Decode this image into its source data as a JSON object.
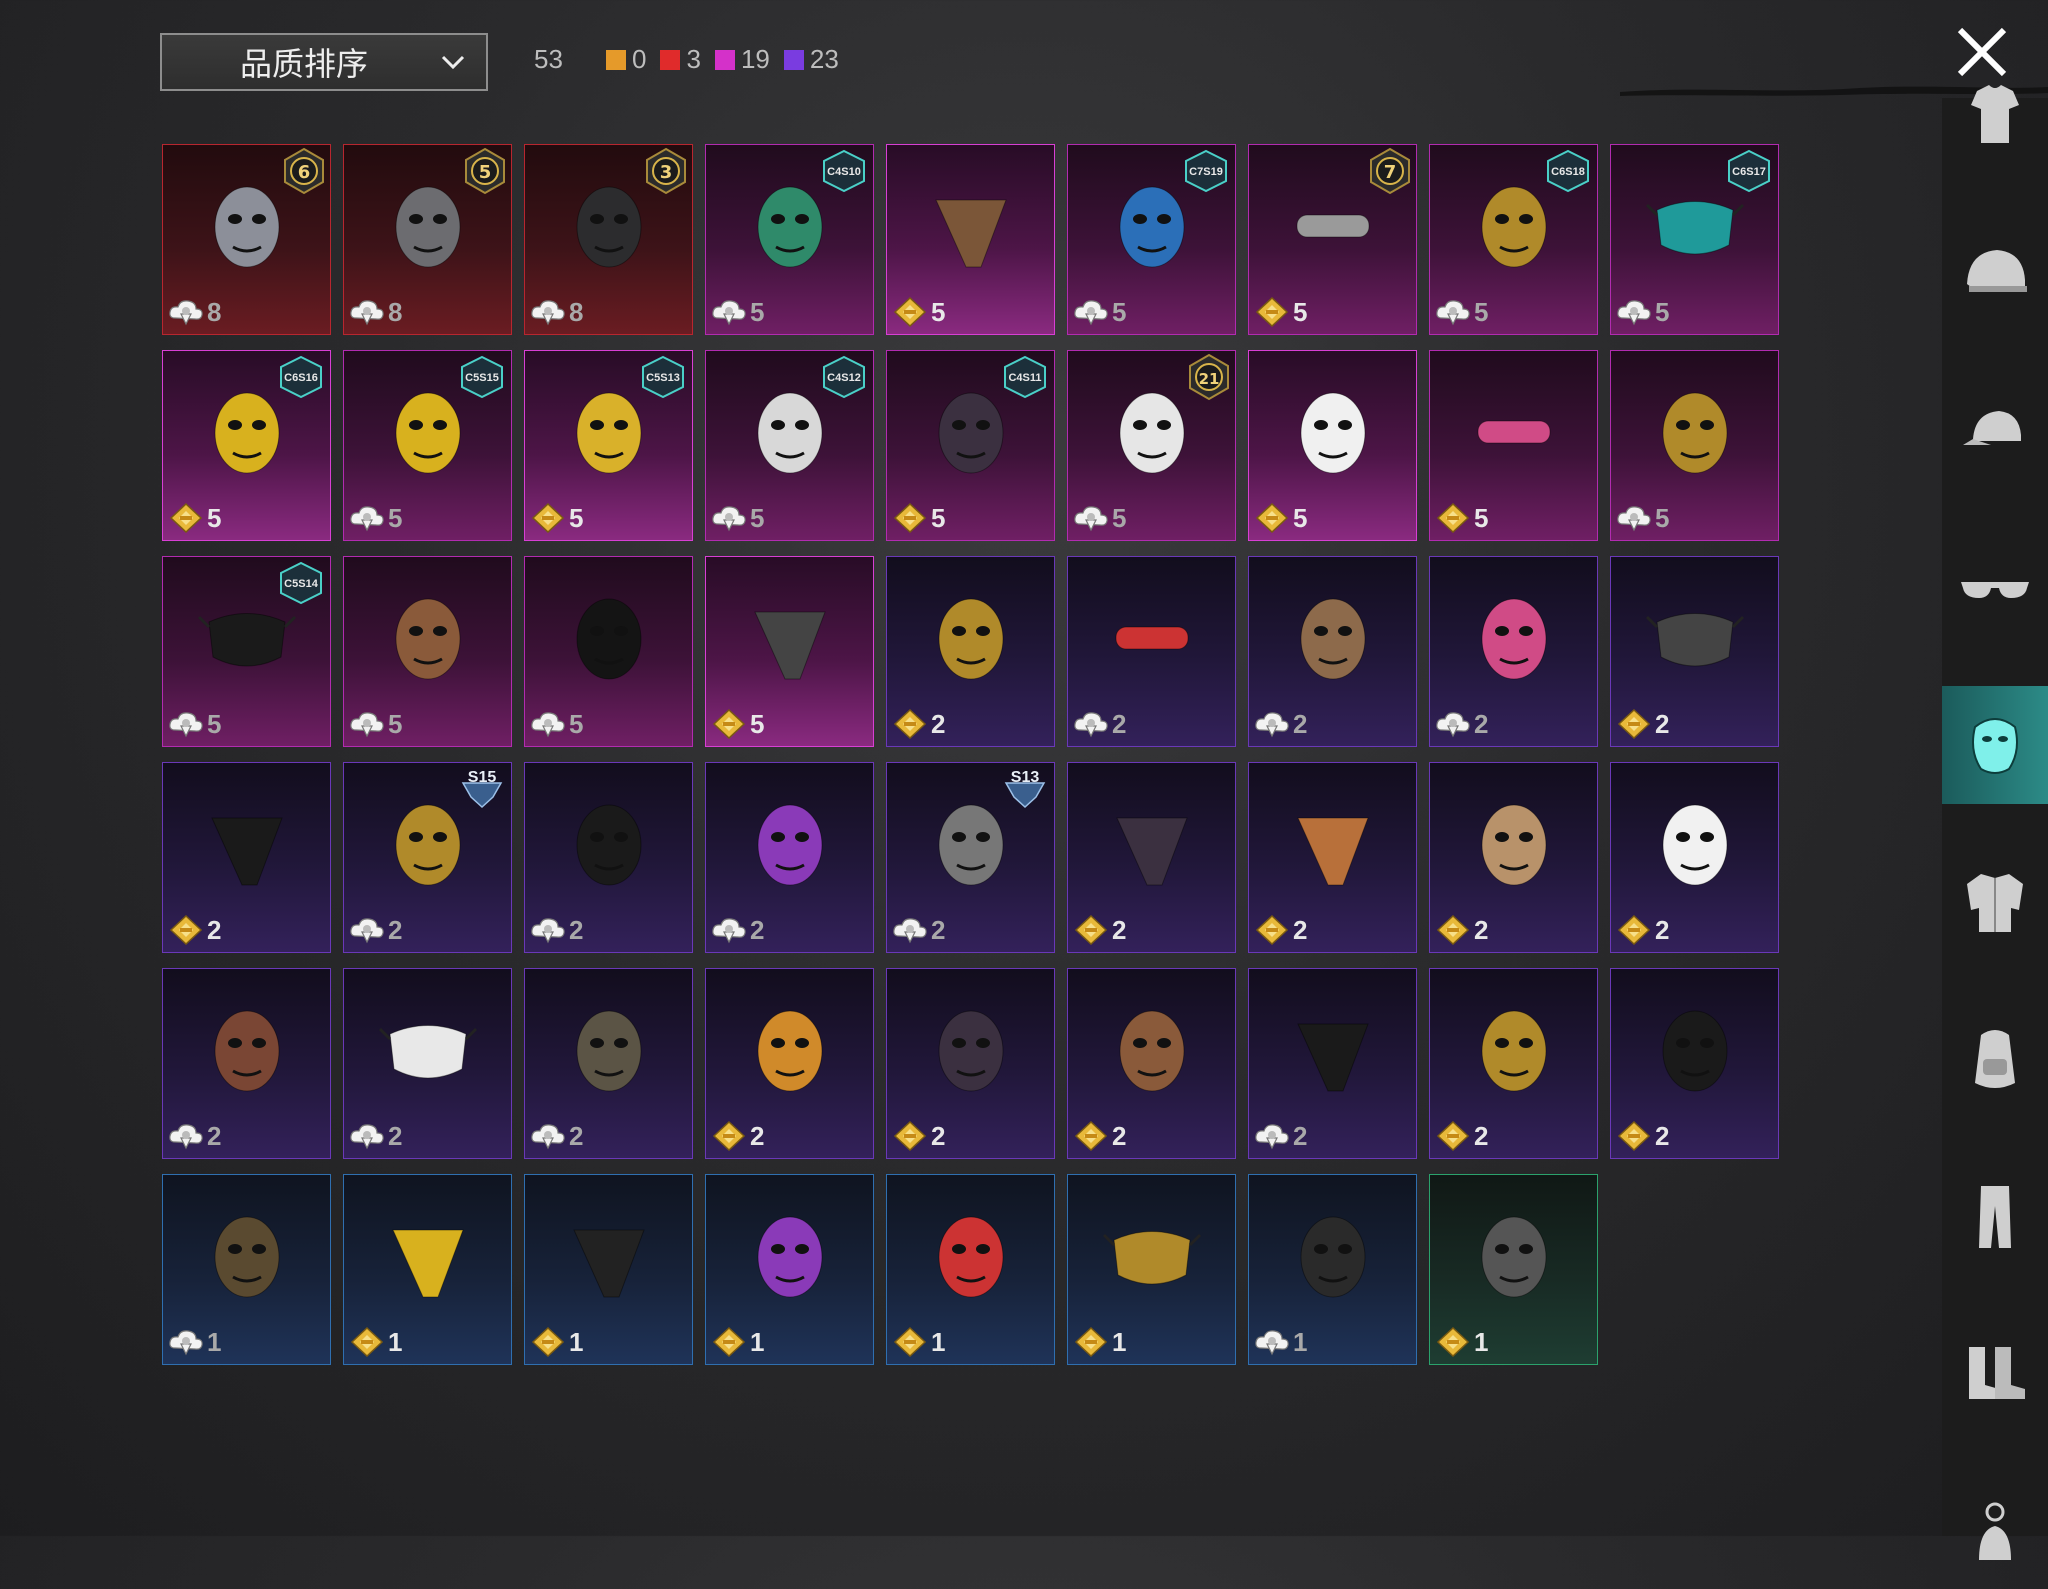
{
  "sort": {
    "label": "品质排序"
  },
  "counts": {
    "total": "53",
    "tiers": [
      {
        "color": "#e59a2a",
        "value": "0"
      },
      {
        "color": "#e02b2b",
        "value": "3"
      },
      {
        "color": "#d431c9",
        "value": "19"
      },
      {
        "color": "#7a3ce0",
        "value": "23"
      }
    ]
  },
  "items": [
    {
      "q": "red",
      "cost": "8",
      "currency": "bp",
      "badge": "6",
      "icon": "plague-doctor-mask-icon"
    },
    {
      "q": "red",
      "cost": "8",
      "currency": "bp",
      "badge": "5",
      "icon": "tech-respirator-icon"
    },
    {
      "q": "red",
      "cost": "8",
      "currency": "bp",
      "badge": "3",
      "icon": "wolf-mask-icon"
    },
    {
      "q": "pink",
      "cost": "5",
      "currency": "bp",
      "season": "C4S10",
      "icon": "green-mask-icon"
    },
    {
      "q": "pinkb",
      "cost": "5",
      "currency": "uc",
      "icon": "brown-bandana-icon"
    },
    {
      "q": "pink",
      "cost": "5",
      "currency": "bp",
      "season": "C7S19",
      "icon": "blue-robot-mask-icon"
    },
    {
      "q": "pink",
      "cost": "5",
      "currency": "uc",
      "badge": "7",
      "icon": "headset-mic-icon"
    },
    {
      "q": "pink",
      "cost": "5",
      "currency": "bp",
      "season": "C6S18",
      "icon": "gold-horns-icon"
    },
    {
      "q": "pink",
      "cost": "5",
      "currency": "bp",
      "season": "C6S17",
      "icon": "teal-face-mask-icon"
    },
    {
      "q": "pinkb",
      "cost": "5",
      "currency": "uc",
      "season": "C6S16",
      "icon": "yellow-gasmask-icon"
    },
    {
      "q": "pink",
      "cost": "5",
      "currency": "bp",
      "season": "C5S15",
      "icon": "yellow-respirator-icon"
    },
    {
      "q": "pinkb",
      "cost": "5",
      "currency": "uc",
      "season": "C5S13",
      "icon": "graffiti-mask-icon"
    },
    {
      "q": "pink",
      "cost": "5",
      "currency": "bp",
      "season": "C4S12",
      "icon": "teeth-mask-icon"
    },
    {
      "q": "pink",
      "cost": "5",
      "currency": "uc",
      "season": "C4S11",
      "icon": "dark-mask-icon"
    },
    {
      "q": "pink",
      "cost": "5",
      "currency": "bp",
      "badge": "21",
      "icon": "joker-mask-icon"
    },
    {
      "q": "pinkb",
      "cost": "5",
      "currency": "uc",
      "icon": "kitsune-mask-icon"
    },
    {
      "q": "pink",
      "cost": "5",
      "currency": "uc",
      "icon": "pink-visor-icon"
    },
    {
      "q": "pink",
      "cost": "5",
      "currency": "bp",
      "icon": "gold-helm-mask-icon"
    },
    {
      "q": "pink",
      "cost": "5",
      "currency": "bp",
      "season": "C5S14",
      "icon": "black-face-mask-icon"
    },
    {
      "q": "pink",
      "cost": "5",
      "currency": "bp",
      "icon": "leather-beak-mask-icon"
    },
    {
      "q": "pink",
      "cost": "5",
      "currency": "bp",
      "icon": "balaclava-icon"
    },
    {
      "q": "pinkb",
      "cost": "5",
      "currency": "uc",
      "icon": "skull-bandana-icon"
    },
    {
      "q": "purple",
      "cost": "2",
      "currency": "uc",
      "icon": "gold-masquerade-icon"
    },
    {
      "q": "purple",
      "cost": "2",
      "currency": "bp",
      "icon": "red-eye-visor-icon"
    },
    {
      "q": "purple",
      "cost": "2",
      "currency": "bp",
      "icon": "mammoth-mask-icon"
    },
    {
      "q": "purple",
      "cost": "2",
      "currency": "bp",
      "icon": "pink-monkey-mask-icon"
    },
    {
      "q": "purple",
      "cost": "2",
      "currency": "uc",
      "icon": "skull-cloth-mask-icon"
    },
    {
      "q": "purple",
      "cost": "2",
      "currency": "uc",
      "icon": "black-bandana-icon"
    },
    {
      "q": "purple",
      "cost": "2",
      "currency": "bp",
      "season": "S15",
      "icon": "gold-skull-mask-icon"
    },
    {
      "q": "purple",
      "cost": "2",
      "currency": "bp",
      "icon": "black-respirator-icon"
    },
    {
      "q": "purple",
      "cost": "2",
      "currency": "bp",
      "icon": "purple-goggle-mask-icon"
    },
    {
      "q": "purple",
      "cost": "2",
      "currency": "bp",
      "season": "S13",
      "icon": "goggle-helmet-icon"
    },
    {
      "q": "purple",
      "cost": "2",
      "currency": "uc",
      "icon": "dark-bandana-icon"
    },
    {
      "q": "purple",
      "cost": "2",
      "currency": "uc",
      "icon": "plaid-bandana-icon"
    },
    {
      "q": "purple",
      "cost": "2",
      "currency": "uc",
      "icon": "tan-gasmask-icon"
    },
    {
      "q": "purple",
      "cost": "2",
      "currency": "uc",
      "icon": "clown-mask-icon"
    },
    {
      "q": "purple",
      "cost": "2",
      "currency": "bp",
      "icon": "monster-jaw-mask-icon"
    },
    {
      "q": "purple",
      "cost": "2",
      "currency": "bp",
      "icon": "grin-face-mask-icon"
    },
    {
      "q": "purple",
      "cost": "2",
      "currency": "bp",
      "icon": "oni-mask-icon"
    },
    {
      "q": "purple",
      "cost": "2",
      "currency": "uc",
      "icon": "orange-hockey-mask-icon"
    },
    {
      "q": "purple",
      "cost": "2",
      "currency": "uc",
      "icon": "dark-skull-mask-icon"
    },
    {
      "q": "purple",
      "cost": "2",
      "currency": "uc",
      "icon": "leather-face-guard-icon"
    },
    {
      "q": "purple",
      "cost": "2",
      "currency": "bp",
      "icon": "black-scarf-icon"
    },
    {
      "q": "purple",
      "cost": "2",
      "currency": "uc",
      "icon": "gold-sequin-mask-icon"
    },
    {
      "q": "purple",
      "cost": "2",
      "currency": "uc",
      "icon": "black-riot-mask-icon"
    },
    {
      "q": "blue",
      "cost": "1",
      "currency": "bp",
      "icon": "rusty-skull-mask-icon"
    },
    {
      "q": "blue",
      "cost": "1",
      "currency": "uc",
      "icon": "yellow-dot-bandana-icon"
    },
    {
      "q": "blue",
      "cost": "1",
      "currency": "uc",
      "icon": "spider-web-bandana-icon"
    },
    {
      "q": "blue",
      "cost": "1",
      "currency": "uc",
      "icon": "purple-theater-mask-icon"
    },
    {
      "q": "blue",
      "cost": "1",
      "currency": "uc",
      "icon": "red-theater-mask-icon"
    },
    {
      "q": "blue",
      "cost": "1",
      "currency": "uc",
      "icon": "gold-print-face-mask-icon"
    },
    {
      "q": "blue",
      "cost": "1",
      "currency": "bp",
      "icon": "half-respirator-icon"
    },
    {
      "q": "green",
      "cost": "1",
      "currency": "uc",
      "icon": "gasmask-icon"
    }
  ],
  "categories": [
    "outfit-icon",
    "helmet-icon",
    "cap-icon",
    "glasses-icon",
    "mask-icon",
    "jacket-icon",
    "backpack-icon",
    "pants-icon",
    "boots-icon",
    "accessory-icon"
  ],
  "active_category": 4
}
